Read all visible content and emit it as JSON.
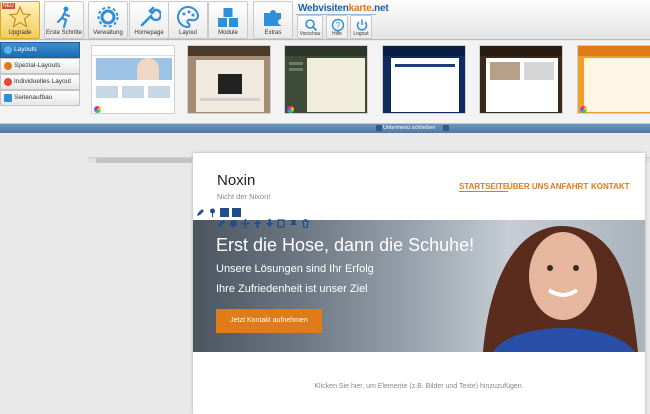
{
  "toolbar": {
    "buttons": [
      {
        "label": "Upgrade",
        "icon": "star-icon"
      },
      {
        "label": "Erste Schritte",
        "icon": "runner-icon"
      },
      {
        "label": "Verwaltung",
        "icon": "gear-icon"
      },
      {
        "label": "Homepage",
        "icon": "wrench-icon"
      },
      {
        "label": "Layout",
        "icon": "palette-icon"
      },
      {
        "label": "Module",
        "icon": "cubes-icon"
      },
      {
        "label": "Extras",
        "icon": "puzzle-icon"
      }
    ],
    "upgrade_badge": "NEU",
    "brand": {
      "part1": "Webvisiten",
      "part2": "karte",
      "part3": ".net"
    },
    "small_buttons": [
      {
        "label": "Vorschau",
        "icon": "search-icon"
      },
      {
        "label": "Hilfe",
        "icon": "help-icon"
      },
      {
        "label": "Logout",
        "icon": "power-icon"
      }
    ],
    "colors": {
      "active": "#f2cc5a",
      "icon": "#2f8fd8",
      "brand_blue": "#1e5fa8",
      "brand_orange": "#e07b1a"
    }
  },
  "panel": {
    "categories": [
      {
        "label": "Layouts",
        "icon": "layouts-icon",
        "color": "#5ab4f0"
      },
      {
        "label": "Spezial-Layouts",
        "icon": "special-icon",
        "color": "#e07b1a"
      },
      {
        "label": "Individuelles Layout",
        "icon": "heart-icon",
        "color": "#e2483a"
      },
      {
        "label": "Seitenaufbau",
        "icon": "structure-icon",
        "color": "#2d8fd8"
      }
    ],
    "thumbnails": [
      {
        "title": "Ihr Firmenname",
        "theme": "white-blue"
      },
      {
        "title": "Ihr Firmenname",
        "theme": "wood-dark"
      },
      {
        "title": "Ihr Firmenname",
        "theme": "dark-green"
      },
      {
        "title": "Ihr Firmenname",
        "theme": "navy"
      },
      {
        "title": "Ihr Firmenname",
        "theme": "brown"
      },
      {
        "title": "Ihr Firmenname",
        "theme": "orange"
      }
    ]
  },
  "closebar": {
    "label": "Untermenü schließen"
  },
  "site": {
    "logo": "Noxin",
    "tagline": "Nicht der Nixon!",
    "nav": [
      "STARTSEITE",
      "ÜBER UNS",
      "ANFAHRT",
      "KONTAKT"
    ],
    "hero": {
      "title": "Erst die Hose, dann die Schuhe!",
      "subtitle1": "Unsere Lösungen sind Ihr Erfolg",
      "subtitle2": "Ihre Zufriedenheit ist unser Ziel",
      "cta": "Jetzt Kontakt aufnehmen"
    },
    "hint": "Klicken Sie hier, um Elemente (z.B. Bilder und Texte) hinzuzufügen.",
    "edit_tools": [
      "edit-icon",
      "move-icon",
      "settings-icon",
      "arrows-icon",
      "up-icon",
      "down-icon",
      "copy-icon",
      "pin-icon",
      "trash-icon"
    ],
    "accent": "#e07b1a"
  }
}
